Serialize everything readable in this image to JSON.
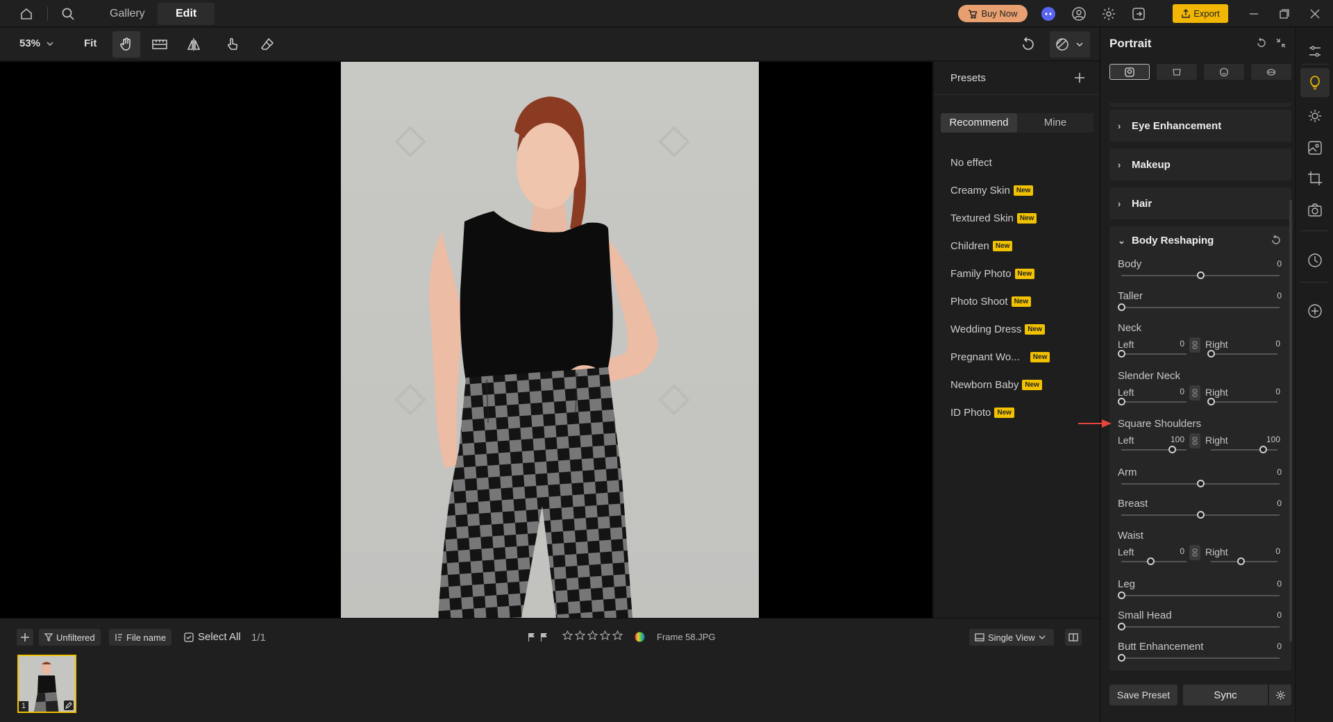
{
  "header": {
    "gallery_tab": "Gallery",
    "edit_tab": "Edit",
    "buy_now": "Buy Now",
    "export": "Export"
  },
  "toolbar": {
    "zoom": "53%",
    "fit": "Fit"
  },
  "presets": {
    "title": "Presets",
    "tab_recommend": "Recommend",
    "tab_mine": "Mine",
    "items": [
      {
        "label": "No effect",
        "badge": ""
      },
      {
        "label": "Creamy Skin",
        "badge": "New"
      },
      {
        "label": "Textured Skin",
        "badge": "New"
      },
      {
        "label": "Children",
        "badge": "New"
      },
      {
        "label": "Family Photo",
        "badge": "New"
      },
      {
        "label": "Photo Shoot",
        "badge": "New"
      },
      {
        "label": "Wedding Dress",
        "badge": "New"
      },
      {
        "label": "Pregnant Wo...",
        "badge": "New"
      },
      {
        "label": "Newborn Baby",
        "badge": "New"
      },
      {
        "label": "ID Photo",
        "badge": "New"
      }
    ]
  },
  "bottom": {
    "filter": "Unfiltered",
    "sort": "File name",
    "select_all": "Select All",
    "count": "1/1",
    "filename": "Frame 58.JPG",
    "view": "Single View",
    "thumb_index": "1"
  },
  "portrait": {
    "title": "Portrait",
    "sections": [
      "Eye Enhancement",
      "Makeup",
      "Hair",
      "Body Reshaping"
    ],
    "body": {
      "label": "Body",
      "value": "0"
    },
    "taller": {
      "label": "Taller",
      "value": "0"
    },
    "neck": {
      "label": "Neck",
      "left_label": "Left",
      "left": "0",
      "right_label": "Right",
      "right": "0"
    },
    "slender_neck": {
      "label": "Slender Neck",
      "left_label": "Left",
      "left": "0",
      "right_label": "Right",
      "right": "0"
    },
    "square_shoulders": {
      "label": "Square Shoulders",
      "left_label": "Left",
      "left": "100",
      "right_label": "Right",
      "right": "100"
    },
    "arm": {
      "label": "Arm",
      "value": "0"
    },
    "breast": {
      "label": "Breast",
      "value": "0"
    },
    "waist": {
      "label": "Waist",
      "left_label": "Left",
      "left": "0",
      "right_label": "Right",
      "right": "0"
    },
    "leg": {
      "label": "Leg",
      "value": "0"
    },
    "small_head": {
      "label": "Small Head",
      "value": "0"
    },
    "butt": {
      "label": "Butt Enhancement",
      "value": "0"
    },
    "save_preset": "Save Preset",
    "sync": "Sync"
  },
  "colors": {
    "accent": "#f2c200",
    "export_bg": "#f2b705",
    "buy_bg": "#e8a070",
    "arrow": "#e5453a"
  }
}
